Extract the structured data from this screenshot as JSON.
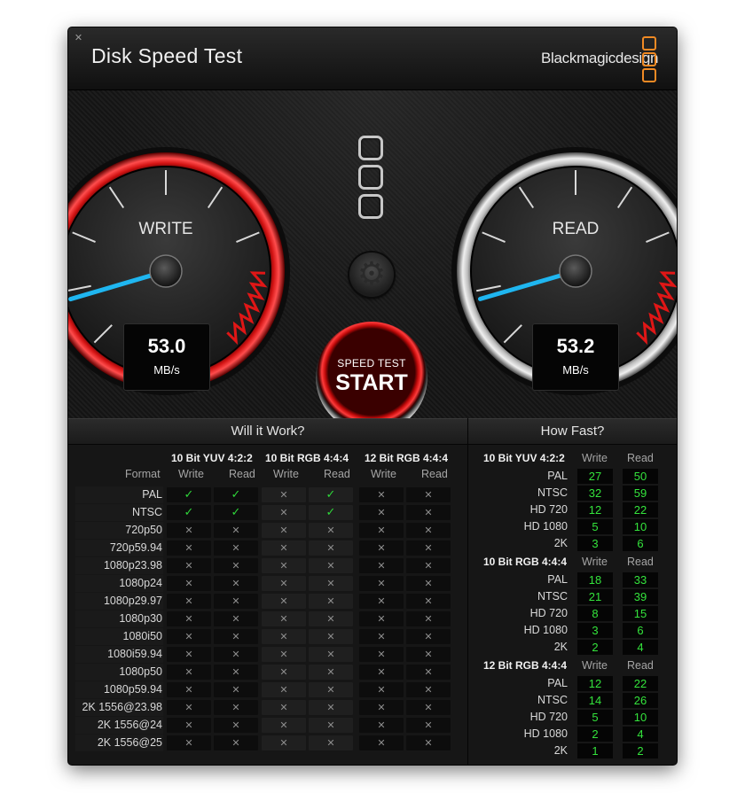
{
  "window": {
    "title": "Disk Speed Test",
    "close_icon": "close-icon",
    "brand": "Blackmagicdesign",
    "brand_color": "#f08a24"
  },
  "gauges": {
    "write": {
      "label": "WRITE",
      "value": "53.0",
      "unit": "MB/s",
      "ring_color": "#c00d0d"
    },
    "read": {
      "label": "READ",
      "value": "53.2",
      "unit": "MB/s",
      "ring_color": "#bdbdbd"
    },
    "needle_color": "#1fb6f0"
  },
  "center": {
    "logo_icon": "blackmagic-logo-icon",
    "settings_icon": "gear-icon",
    "start_top": "SPEED TEST",
    "start_main": "START"
  },
  "will_it_work": {
    "title": "Will it Work?",
    "format_label": "Format",
    "groups": [
      "10 Bit YUV 4:2:2",
      "10 Bit RGB 4:4:4",
      "12 Bit RGB 4:4:4"
    ],
    "sub_write": "Write",
    "sub_read": "Read",
    "rows": [
      {
        "format": "PAL",
        "marks": [
          true,
          true,
          false,
          true,
          false,
          false
        ]
      },
      {
        "format": "NTSC",
        "marks": [
          true,
          true,
          false,
          true,
          false,
          false
        ]
      },
      {
        "format": "720p50",
        "marks": [
          false,
          false,
          false,
          false,
          false,
          false
        ]
      },
      {
        "format": "720p59.94",
        "marks": [
          false,
          false,
          false,
          false,
          false,
          false
        ]
      },
      {
        "format": "1080p23.98",
        "marks": [
          false,
          false,
          false,
          false,
          false,
          false
        ]
      },
      {
        "format": "1080p24",
        "marks": [
          false,
          false,
          false,
          false,
          false,
          false
        ]
      },
      {
        "format": "1080p29.97",
        "marks": [
          false,
          false,
          false,
          false,
          false,
          false
        ]
      },
      {
        "format": "1080p30",
        "marks": [
          false,
          false,
          false,
          false,
          false,
          false
        ]
      },
      {
        "format": "1080i50",
        "marks": [
          false,
          false,
          false,
          false,
          false,
          false
        ]
      },
      {
        "format": "1080i59.94",
        "marks": [
          false,
          false,
          false,
          false,
          false,
          false
        ]
      },
      {
        "format": "1080p50",
        "marks": [
          false,
          false,
          false,
          false,
          false,
          false
        ]
      },
      {
        "format": "1080p59.94",
        "marks": [
          false,
          false,
          false,
          false,
          false,
          false
        ]
      },
      {
        "format": "2K 1556@23.98",
        "marks": [
          false,
          false,
          false,
          false,
          false,
          false
        ]
      },
      {
        "format": "2K 1556@24",
        "marks": [
          false,
          false,
          false,
          false,
          false,
          false
        ]
      },
      {
        "format": "2K 1556@25",
        "marks": [
          false,
          false,
          false,
          false,
          false,
          false
        ]
      }
    ]
  },
  "how_fast": {
    "title": "How Fast?",
    "sub_write": "Write",
    "sub_read": "Read",
    "value_color": "#34e33c",
    "groups": [
      {
        "name": "10 Bit YUV 4:2:2",
        "rows": [
          {
            "format": "PAL",
            "write": "27",
            "read": "50"
          },
          {
            "format": "NTSC",
            "write": "32",
            "read": "59"
          },
          {
            "format": "HD 720",
            "write": "12",
            "read": "22"
          },
          {
            "format": "HD 1080",
            "write": "5",
            "read": "10"
          },
          {
            "format": "2K",
            "write": "3",
            "read": "6"
          }
        ]
      },
      {
        "name": "10 Bit RGB 4:4:4",
        "rows": [
          {
            "format": "PAL",
            "write": "18",
            "read": "33"
          },
          {
            "format": "NTSC",
            "write": "21",
            "read": "39"
          },
          {
            "format": "HD 720",
            "write": "8",
            "read": "15"
          },
          {
            "format": "HD 1080",
            "write": "3",
            "read": "6"
          },
          {
            "format": "2K",
            "write": "2",
            "read": "4"
          }
        ]
      },
      {
        "name": "12 Bit RGB 4:4:4",
        "rows": [
          {
            "format": "PAL",
            "write": "12",
            "read": "22"
          },
          {
            "format": "NTSC",
            "write": "14",
            "read": "26"
          },
          {
            "format": "HD 720",
            "write": "5",
            "read": "10"
          },
          {
            "format": "HD 1080",
            "write": "2",
            "read": "4"
          },
          {
            "format": "2K",
            "write": "1",
            "read": "2"
          }
        ]
      }
    ]
  }
}
